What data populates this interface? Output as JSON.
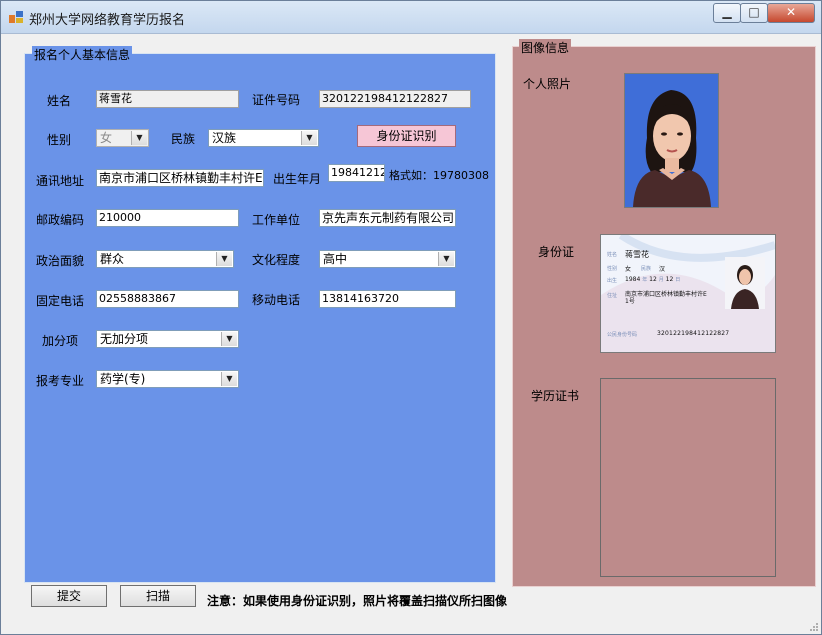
{
  "window": {
    "title": "郑州大学网络教育学历报名",
    "min": "▁",
    "max": "□",
    "close": "✕"
  },
  "basic_info": {
    "legend": "报名个人基本信息",
    "name_label": "姓名",
    "name_value": "蒋雪花",
    "id_label": "证件号码",
    "id_value": "320122198412122827",
    "gender_label": "性别",
    "gender_value": "女",
    "ethnicity_label": "民族",
    "ethnicity_value": "汉族",
    "id_recognize_button": "身份证识别",
    "address_label": "通讯地址",
    "address_value": "南京市浦口区桥林镇勤丰村许E",
    "birth_label": "出生年月",
    "birth_value": "19841212",
    "birth_format_hint": "格式如：19780308",
    "zip_label": "邮政编码",
    "zip_value": "210000",
    "employer_label": "工作单位",
    "employer_value": "京先声东元制药有限公司",
    "political_label": "政治面貌",
    "political_value": "群众",
    "education_label": "文化程度",
    "education_value": "高中",
    "phone_label": "固定电话",
    "phone_value": "02558883867",
    "mobile_label": "移动电话",
    "mobile_value": "13814163720",
    "bonus_label": "加分项",
    "bonus_value": "无加分项",
    "major_label": "报考专业",
    "major_value": "药学(专)"
  },
  "image_info": {
    "legend": "图像信息",
    "photo_label": "个人照片",
    "idcard_label": "身份证",
    "diploma_label": "学历证书",
    "idcard": {
      "name_field": "姓名",
      "name": "蒋雪花",
      "gender_field": "性别",
      "gender": "女",
      "ethnic_field": "民族",
      "ethnic": "汉",
      "birth_field": "出生",
      "birth_year": "1984",
      "year_unit": "年",
      "birth_month": "12",
      "month_unit": "月",
      "birth_day": "12",
      "day_unit": "日",
      "address_field": "住址",
      "address_line1": "南京市浦口区桥林镇勤丰村许E",
      "address_line2": "1号",
      "number_field": "公民身份号码",
      "number": "320122198412122827"
    }
  },
  "footer": {
    "submit_button": "提交",
    "scan_button": "扫描",
    "note": "注意：如果使用身份证识别，照片将覆盖扫描仪所扫图像"
  },
  "colors": {
    "basic_panel": "#6a93e8",
    "image_panel": "#bd8b8b",
    "id_button": "#f6c6d6"
  }
}
